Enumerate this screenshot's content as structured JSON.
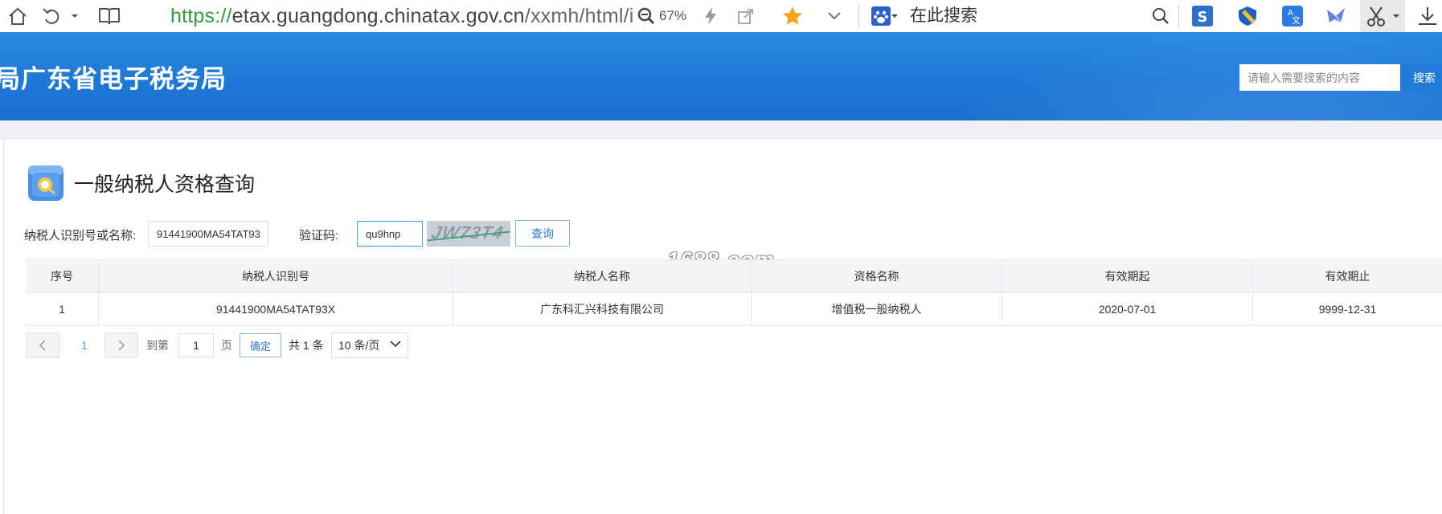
{
  "browser": {
    "url_scheme": "https://",
    "url_host": "etax.guangdong.chinatax.gov.cn",
    "url_path": "/xxmh/html/i",
    "zoom": "67%",
    "search_text": "在此搜索"
  },
  "header": {
    "title": "局广东省电子税务局",
    "search_placeholder": "请输入需要搜索的内容",
    "search_button": "搜索"
  },
  "page": {
    "title": "一般纳税人资格查询"
  },
  "form": {
    "taxpayer_label": "纳税人识别号或名称:",
    "taxpayer_value": "91441900MA54TAT93X",
    "captcha_label": "验证码:",
    "captcha_value": "qu9hnp",
    "captcha_image_text": "JW73T4",
    "query_button": "查询"
  },
  "watermark": "1688.com",
  "table": {
    "headers": [
      "序号",
      "纳税人识别号",
      "纳税人名称",
      "资格名称",
      "有效期起",
      "有效期止"
    ],
    "rows": [
      [
        "1",
        "91441900MA54TAT93X",
        "广东科汇兴科技有限公司",
        "增值税一般纳税人",
        "2020-07-01",
        "9999-12-31"
      ]
    ]
  },
  "pagination": {
    "current_page": "1",
    "goto_label": "到第",
    "goto_value": "1",
    "page_unit": "页",
    "confirm_button": "确定",
    "total_text": "共 1 条",
    "page_size": "10 条/页"
  },
  "colors": {
    "header_blue": "#1e78d6",
    "accent": "#409eff",
    "url_green": "#2e9c3a"
  }
}
